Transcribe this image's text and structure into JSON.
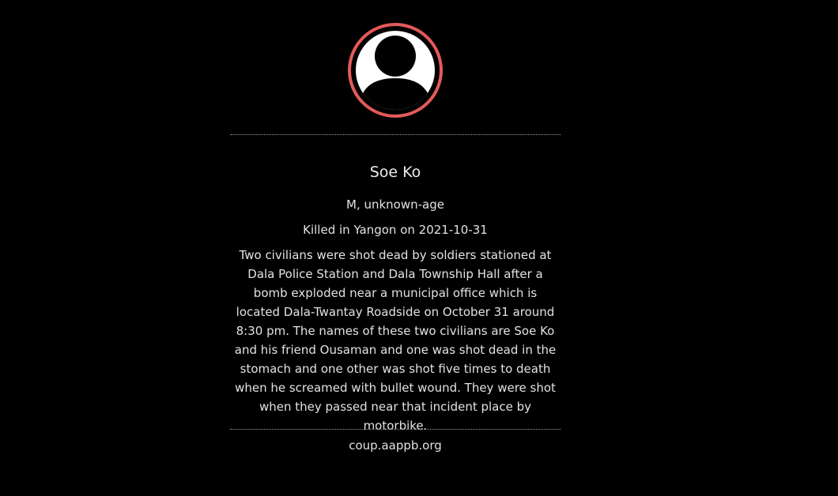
{
  "profile": {
    "name": "Soe Ko",
    "sex_age": "M, unknown-age",
    "killed": "Killed in Yangon on 2021-10-31",
    "description": "Two civilians were shot dead by soldiers stationed at Dala Police Station and Dala Township Hall after a bomb exploded near a municipal office which is located Dala-Twantay Roadside on October 31 around 8:30 pm. The names of these two civilians are Soe Ko and his friend Ousaman and one was shot dead in the stomach and one other was shot five times to death when he screamed with bullet wound. They were shot when they passed near that incident place by motorbike.",
    "avatar_icon": "default-person-icon",
    "avatar_ring_color": "#e45a5a"
  },
  "footer": {
    "source": "coup.aappb.org"
  },
  "colors": {
    "background": "#000000",
    "text": "#e2e2e2",
    "accent": "#e45a5a"
  }
}
